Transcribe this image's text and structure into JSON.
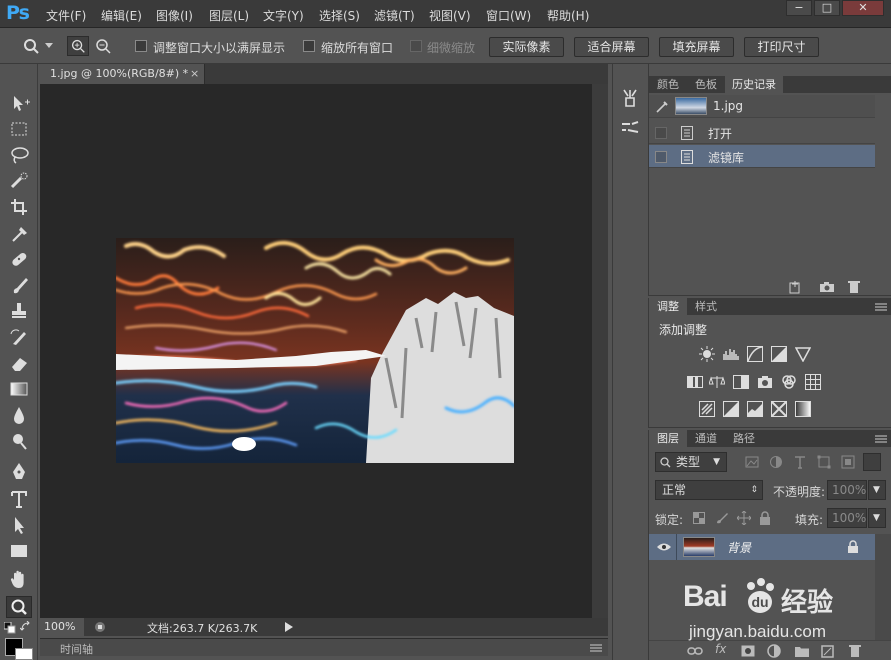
{
  "app": {
    "logo": "Ps"
  },
  "menu": [
    "文件(F)",
    "编辑(E)",
    "图像(I)",
    "图层(L)",
    "文字(Y)",
    "选择(S)",
    "滤镜(T)",
    "视图(V)",
    "窗口(W)",
    "帮助(H)"
  ],
  "window_buttons": {
    "minimize": "−",
    "maximize": "□",
    "close": "✕"
  },
  "options": {
    "resize_windows_label": "调整窗口大小以满屏显示",
    "zoom_all_windows_label": "缩放所有窗口",
    "scrubby_zoom_label": "细微缩放",
    "actual_pixels": "实际像素",
    "fit_screen": "适合屏幕",
    "fill_screen": "填充屏幕",
    "print_size": "打印尺寸"
  },
  "document": {
    "tab_title": "1.jpg @ 100%(RGB/8#) *",
    "close_glyph": "×"
  },
  "status": {
    "zoom": "100%",
    "doc_size": "文档:263.7 K/263.7K"
  },
  "timeline": {
    "label": "时间轴"
  },
  "history_panel": {
    "tabs": [
      "颜色",
      "色板",
      "历史记录"
    ],
    "active_tab": 2,
    "snapshot": "1.jpg",
    "states": [
      "打开",
      "滤镜库"
    ],
    "selected_state": 1
  },
  "adjustments_panel": {
    "tabs": [
      "调整",
      "样式"
    ],
    "heading": "添加调整"
  },
  "layers_panel": {
    "tabs": [
      "图层",
      "通道",
      "路径"
    ],
    "filter_kind": "类型",
    "blend_mode": "正常",
    "opacity_label": "不透明度:",
    "opacity_value": "100%",
    "lock_label": "锁定:",
    "fill_label": "填充:",
    "fill_value": "100%",
    "layers": [
      {
        "name": "背景",
        "visible": true,
        "locked": true
      }
    ]
  },
  "watermark": {
    "brand": "Bai",
    "brand2": "经验",
    "url": "jingyan.baidu.com"
  }
}
